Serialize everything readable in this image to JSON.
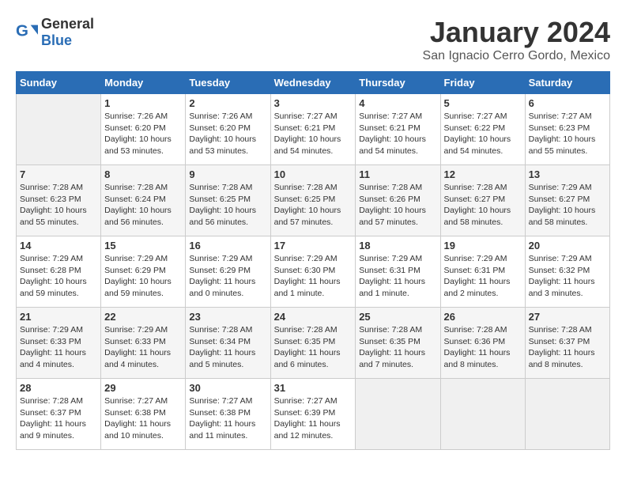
{
  "logo": {
    "general": "General",
    "blue": "Blue"
  },
  "header": {
    "title": "January 2024",
    "subtitle": "San Ignacio Cerro Gordo, Mexico"
  },
  "weekdays": [
    "Sunday",
    "Monday",
    "Tuesday",
    "Wednesday",
    "Thursday",
    "Friday",
    "Saturday"
  ],
  "weeks": [
    [
      {
        "day": "",
        "info": ""
      },
      {
        "day": "1",
        "info": "Sunrise: 7:26 AM\nSunset: 6:20 PM\nDaylight: 10 hours\nand 53 minutes."
      },
      {
        "day": "2",
        "info": "Sunrise: 7:26 AM\nSunset: 6:20 PM\nDaylight: 10 hours\nand 53 minutes."
      },
      {
        "day": "3",
        "info": "Sunrise: 7:27 AM\nSunset: 6:21 PM\nDaylight: 10 hours\nand 54 minutes."
      },
      {
        "day": "4",
        "info": "Sunrise: 7:27 AM\nSunset: 6:21 PM\nDaylight: 10 hours\nand 54 minutes."
      },
      {
        "day": "5",
        "info": "Sunrise: 7:27 AM\nSunset: 6:22 PM\nDaylight: 10 hours\nand 54 minutes."
      },
      {
        "day": "6",
        "info": "Sunrise: 7:27 AM\nSunset: 6:23 PM\nDaylight: 10 hours\nand 55 minutes."
      }
    ],
    [
      {
        "day": "7",
        "info": "Sunrise: 7:28 AM\nSunset: 6:23 PM\nDaylight: 10 hours\nand 55 minutes."
      },
      {
        "day": "8",
        "info": "Sunrise: 7:28 AM\nSunset: 6:24 PM\nDaylight: 10 hours\nand 56 minutes."
      },
      {
        "day": "9",
        "info": "Sunrise: 7:28 AM\nSunset: 6:25 PM\nDaylight: 10 hours\nand 56 minutes."
      },
      {
        "day": "10",
        "info": "Sunrise: 7:28 AM\nSunset: 6:25 PM\nDaylight: 10 hours\nand 57 minutes."
      },
      {
        "day": "11",
        "info": "Sunrise: 7:28 AM\nSunset: 6:26 PM\nDaylight: 10 hours\nand 57 minutes."
      },
      {
        "day": "12",
        "info": "Sunrise: 7:28 AM\nSunset: 6:27 PM\nDaylight: 10 hours\nand 58 minutes."
      },
      {
        "day": "13",
        "info": "Sunrise: 7:29 AM\nSunset: 6:27 PM\nDaylight: 10 hours\nand 58 minutes."
      }
    ],
    [
      {
        "day": "14",
        "info": "Sunrise: 7:29 AM\nSunset: 6:28 PM\nDaylight: 10 hours\nand 59 minutes."
      },
      {
        "day": "15",
        "info": "Sunrise: 7:29 AM\nSunset: 6:29 PM\nDaylight: 10 hours\nand 59 minutes."
      },
      {
        "day": "16",
        "info": "Sunrise: 7:29 AM\nSunset: 6:29 PM\nDaylight: 11 hours\nand 0 minutes."
      },
      {
        "day": "17",
        "info": "Sunrise: 7:29 AM\nSunset: 6:30 PM\nDaylight: 11 hours\nand 1 minute."
      },
      {
        "day": "18",
        "info": "Sunrise: 7:29 AM\nSunset: 6:31 PM\nDaylight: 11 hours\nand 1 minute."
      },
      {
        "day": "19",
        "info": "Sunrise: 7:29 AM\nSunset: 6:31 PM\nDaylight: 11 hours\nand 2 minutes."
      },
      {
        "day": "20",
        "info": "Sunrise: 7:29 AM\nSunset: 6:32 PM\nDaylight: 11 hours\nand 3 minutes."
      }
    ],
    [
      {
        "day": "21",
        "info": "Sunrise: 7:29 AM\nSunset: 6:33 PM\nDaylight: 11 hours\nand 4 minutes."
      },
      {
        "day": "22",
        "info": "Sunrise: 7:29 AM\nSunset: 6:33 PM\nDaylight: 11 hours\nand 4 minutes."
      },
      {
        "day": "23",
        "info": "Sunrise: 7:28 AM\nSunset: 6:34 PM\nDaylight: 11 hours\nand 5 minutes."
      },
      {
        "day": "24",
        "info": "Sunrise: 7:28 AM\nSunset: 6:35 PM\nDaylight: 11 hours\nand 6 minutes."
      },
      {
        "day": "25",
        "info": "Sunrise: 7:28 AM\nSunset: 6:35 PM\nDaylight: 11 hours\nand 7 minutes."
      },
      {
        "day": "26",
        "info": "Sunrise: 7:28 AM\nSunset: 6:36 PM\nDaylight: 11 hours\nand 8 minutes."
      },
      {
        "day": "27",
        "info": "Sunrise: 7:28 AM\nSunset: 6:37 PM\nDaylight: 11 hours\nand 8 minutes."
      }
    ],
    [
      {
        "day": "28",
        "info": "Sunrise: 7:28 AM\nSunset: 6:37 PM\nDaylight: 11 hours\nand 9 minutes."
      },
      {
        "day": "29",
        "info": "Sunrise: 7:27 AM\nSunset: 6:38 PM\nDaylight: 11 hours\nand 10 minutes."
      },
      {
        "day": "30",
        "info": "Sunrise: 7:27 AM\nSunset: 6:38 PM\nDaylight: 11 hours\nand 11 minutes."
      },
      {
        "day": "31",
        "info": "Sunrise: 7:27 AM\nSunset: 6:39 PM\nDaylight: 11 hours\nand 12 minutes."
      },
      {
        "day": "",
        "info": ""
      },
      {
        "day": "",
        "info": ""
      },
      {
        "day": "",
        "info": ""
      }
    ]
  ]
}
